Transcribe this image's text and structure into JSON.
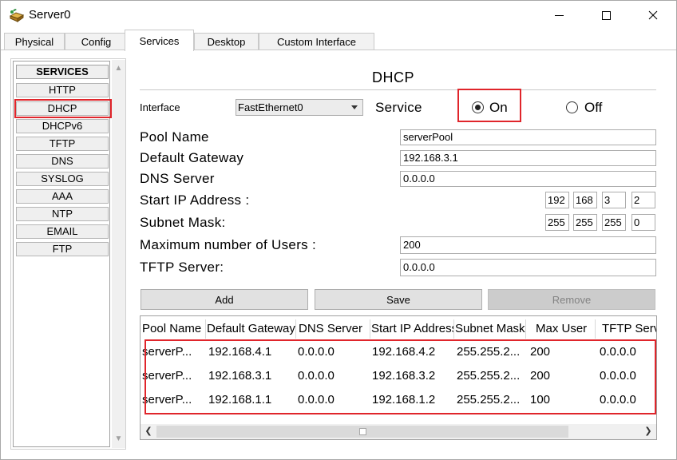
{
  "window": {
    "title": "Server0"
  },
  "tabs": [
    "Physical",
    "Config",
    "Services",
    "Desktop",
    "Custom Interface"
  ],
  "sidebar": {
    "header": "SERVICES",
    "items": [
      "HTTP",
      "DHCP",
      "DHCPv6",
      "TFTP",
      "DNS",
      "SYSLOG",
      "AAA",
      "NTP",
      "EMAIL",
      "FTP"
    ],
    "selected": "DHCP"
  },
  "dhcp": {
    "heading": "DHCP",
    "interface_label": "Interface",
    "interface_value": "FastEthernet0",
    "service_label": "Service",
    "on_label": "On",
    "off_label": "Off",
    "service_state": "On",
    "pool_name_label": "Pool Name",
    "pool_name_value": "serverPool",
    "gateway_label": "Default Gateway",
    "gateway_value": "192.168.3.1",
    "dns_label": "DNS Server",
    "dns_value": "0.0.0.0",
    "start_ip_label": "Start IP Address :",
    "start_ip": [
      "192",
      "168",
      "3",
      "2"
    ],
    "subnet_label": "Subnet Mask:",
    "subnet": [
      "255",
      "255",
      "255",
      "0"
    ],
    "max_users_label": "Maximum number of Users :",
    "max_users_value": "200",
    "tftp_label": "TFTP Server:",
    "tftp_value": "0.0.0.0",
    "add_label": "Add",
    "save_label": "Save",
    "remove_label": "Remove"
  },
  "table": {
    "columns": [
      "Pool Name",
      "Default Gateway",
      "DNS Server",
      "Start IP Address",
      "Subnet Mask",
      "Max User",
      "TFTP Server"
    ],
    "rows": [
      [
        "serverP...",
        "192.168.4.1",
        "0.0.0.0",
        "192.168.4.2",
        "255.255.2...",
        "200",
        "0.0.0.0"
      ],
      [
        "serverP...",
        "192.168.3.1",
        "0.0.0.0",
        "192.168.3.2",
        "255.255.2...",
        "200",
        "0.0.0.0"
      ],
      [
        "serverP...",
        "192.168.1.1",
        "0.0.0.0",
        "192.168.1.2",
        "255.255.2...",
        "100",
        "0.0.0.0"
      ]
    ]
  },
  "colors": {
    "highlight": "#e0252b",
    "button": "#e1e1e1",
    "disabled_button": "#cccccc"
  }
}
